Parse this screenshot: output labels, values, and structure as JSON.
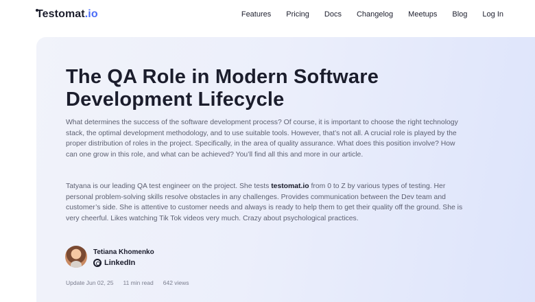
{
  "header": {
    "logo": {
      "prefix": "Testomat",
      "accent": ".io"
    },
    "nav": [
      "Features",
      "Pricing",
      "Docs",
      "Changelog",
      "Meetups",
      "Blog",
      "Log In"
    ]
  },
  "article": {
    "title": "The QA Role in Modern Software Development Lifecycle",
    "intro": "What determines the success of the software development process? Of course, it is important to choose the right technology stack, the optimal development methodology, and to use suitable tools. However, that’s not all. A crucial role is played by the proper distribution of roles in the project. Specifically, in the area of quality assurance. What does this position involve? How can one grow in this role, and what can be achieved? You’ll find all this and more in our article.",
    "bio": {
      "before": "Tatyana is our leading QA test engineer on the project. She tests ",
      "bold": "testomat.io",
      "after": " from 0 to Z by various types of testing. Her personal problem-solving skills resolve obstacles in any challenges. Provides communication between the Dev team and customer’s side. She is attentive to customer needs and always is ready to help them to get their quality off the ground. She is very cheerful. Likes watching Tik Tok videos very much. Crazy about psychological practices."
    },
    "author": {
      "name": "Tetiana Khomenko",
      "link_label": "LinkedIn"
    },
    "meta": {
      "updated": "Update Jun 02, 25",
      "read_time": "11 min read",
      "views": "642 views"
    }
  },
  "colors": {
    "accent": "#4a6cf7",
    "text": "#1b1d2c",
    "hero_bg": "#eceffb"
  }
}
